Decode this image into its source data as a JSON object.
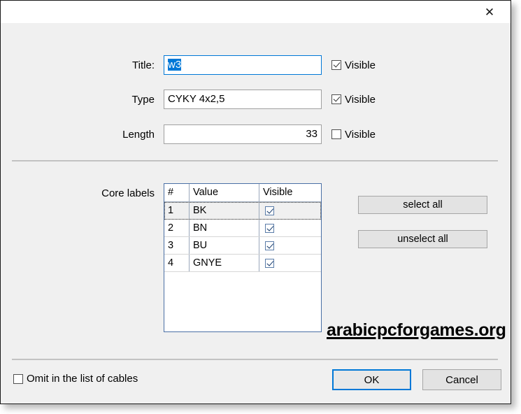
{
  "window": {
    "close_icon": "close-icon",
    "close_glyph": "✕",
    "title": ""
  },
  "form": {
    "title_row": {
      "label": "Title:",
      "value": "w3",
      "value_selected": true,
      "visible_label": "Visible",
      "visible_checked": true
    },
    "type_row": {
      "label": "Type",
      "value": "CYKY 4x2,5",
      "visible_label": "Visible",
      "visible_checked": true
    },
    "length_row": {
      "label": "Length",
      "value": "33",
      "visible_label": "Visible",
      "visible_checked": false
    }
  },
  "core_labels": {
    "label": "Core labels",
    "columns": [
      "#",
      "Value",
      "Visible"
    ],
    "rows": [
      {
        "num": "1",
        "value": "BK",
        "visible": true,
        "selected": true
      },
      {
        "num": "2",
        "value": "BN",
        "visible": true,
        "selected": false
      },
      {
        "num": "3",
        "value": "BU",
        "visible": true,
        "selected": false
      },
      {
        "num": "4",
        "value": "GNYE",
        "visible": true,
        "selected": false
      }
    ],
    "select_all_label": "select all",
    "unselect_all_label": "unselect all"
  },
  "watermark": {
    "text": "arabicpcforgames.org"
  },
  "footer": {
    "omit_label": "Omit in the list of cables",
    "omit_checked": false,
    "ok_label": "OK",
    "cancel_label": "Cancel"
  },
  "colors": {
    "accent": "#0078d7",
    "dialog_bg": "#f0f0f0",
    "field_bg": "#ffffff",
    "grid_border": "#4a6fa5",
    "button_bg": "#e3e3e3"
  }
}
